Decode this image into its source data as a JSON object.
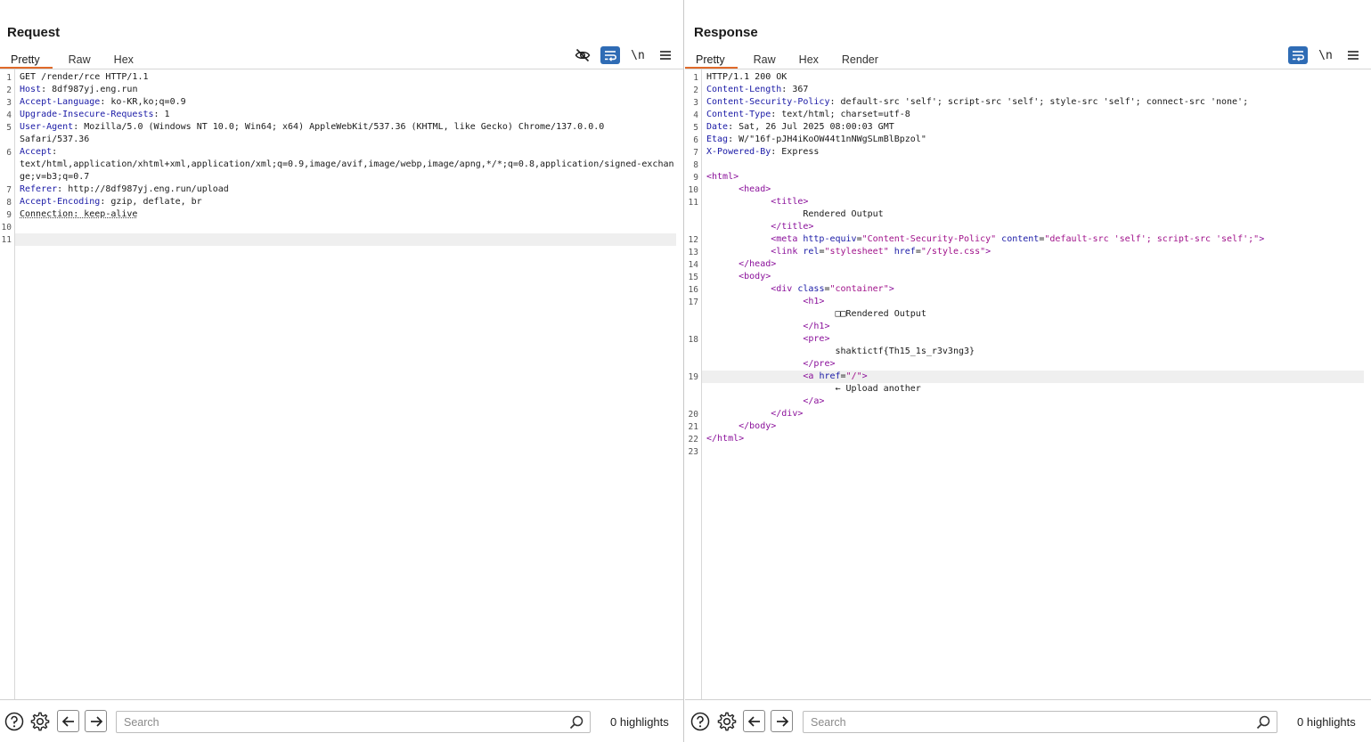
{
  "request": {
    "title": "Request",
    "tabs": [
      "Pretty",
      "Raw",
      "Hex"
    ],
    "active_tab": "Pretty",
    "newline_toggle": "\\n",
    "lines": [
      {
        "n": "1",
        "parts": [
          [
            "t",
            "GET /render/rce HTTP/1.1"
          ]
        ]
      },
      {
        "n": "2",
        "parts": [
          [
            "k",
            "Host"
          ],
          [
            "t",
            ": 8df987yj.eng.run"
          ]
        ]
      },
      {
        "n": "3",
        "parts": [
          [
            "k",
            "Accept-Language"
          ],
          [
            "t",
            ": ko-KR,ko;q=0.9"
          ]
        ]
      },
      {
        "n": "4",
        "parts": [
          [
            "k",
            "Upgrade-Insecure-Requests"
          ],
          [
            "t",
            ": 1"
          ]
        ]
      },
      {
        "n": "5",
        "parts": [
          [
            "k",
            "User-Agent"
          ],
          [
            "t",
            ": Mozilla/5.0 (Windows NT 10.0; Win64; x64) AppleWebKit/537.36 (KHTML, like Gecko) Chrome/137.0.0.0"
          ]
        ]
      },
      {
        "n": "",
        "parts": [
          [
            "t",
            "Safari/537.36"
          ]
        ]
      },
      {
        "n": "6",
        "parts": [
          [
            "k",
            "Accept"
          ],
          [
            "t",
            ":"
          ]
        ]
      },
      {
        "n": "",
        "parts": [
          [
            "t",
            "text/html,application/xhtml+xml,application/xml;q=0.9,image/avif,image/webp,image/apng,*/*;q=0.8,application/signed-exchan"
          ]
        ]
      },
      {
        "n": "",
        "parts": [
          [
            "t",
            "ge;v=b3;q=0.7"
          ]
        ]
      },
      {
        "n": "7",
        "parts": [
          [
            "k",
            "Referer"
          ],
          [
            "t",
            ": http://8df987yj.eng.run/upload"
          ]
        ]
      },
      {
        "n": "8",
        "parts": [
          [
            "k",
            "Accept-Encoding"
          ],
          [
            "t",
            ": gzip, deflate, br"
          ]
        ]
      },
      {
        "n": "9",
        "parts": [
          [
            "u",
            "Connection: keep-alive"
          ]
        ]
      },
      {
        "n": "10",
        "parts": []
      },
      {
        "n": "11",
        "parts": [],
        "hl": true
      }
    ],
    "search_placeholder": "Search",
    "highlights": "0 highlights"
  },
  "response": {
    "title": "Response",
    "tabs": [
      "Pretty",
      "Raw",
      "Hex",
      "Render"
    ],
    "active_tab": "Pretty",
    "newline_toggle": "\\n",
    "lines": [
      {
        "n": "1",
        "parts": [
          [
            "t",
            "HTTP/1.1 200 OK"
          ]
        ]
      },
      {
        "n": "2",
        "parts": [
          [
            "k",
            "Content-Length"
          ],
          [
            "t",
            ": 367"
          ]
        ]
      },
      {
        "n": "3",
        "parts": [
          [
            "k",
            "Content-Security-Policy"
          ],
          [
            "t",
            ": default-src 'self'; script-src 'self'; style-src 'self'; connect-src 'none';"
          ]
        ]
      },
      {
        "n": "4",
        "parts": [
          [
            "k",
            "Content-Type"
          ],
          [
            "t",
            ": text/html; charset=utf-8"
          ]
        ]
      },
      {
        "n": "5",
        "parts": [
          [
            "k",
            "Date"
          ],
          [
            "t",
            ": Sat, 26 Jul 2025 08:00:03 GMT"
          ]
        ]
      },
      {
        "n": "6",
        "parts": [
          [
            "k",
            "Etag"
          ],
          [
            "t",
            ": W/\"16f-pJH4iKoOW44t1nNWgSLmBlBpzol\""
          ]
        ]
      },
      {
        "n": "7",
        "parts": [
          [
            "k",
            "X-Powered-By"
          ],
          [
            "t",
            ": Express"
          ]
        ]
      },
      {
        "n": "8",
        "parts": []
      },
      {
        "n": "9",
        "parts": [
          [
            "g",
            "<html>"
          ]
        ]
      },
      {
        "n": "10",
        "parts": [
          [
            "t",
            "      "
          ],
          [
            "g",
            "<head>"
          ]
        ]
      },
      {
        "n": "11",
        "parts": [
          [
            "t",
            "            "
          ],
          [
            "g",
            "<title>"
          ]
        ]
      },
      {
        "n": "",
        "parts": [
          [
            "t",
            "                  Rendered Output"
          ]
        ]
      },
      {
        "n": "",
        "parts": [
          [
            "t",
            "            "
          ],
          [
            "g",
            "</title>"
          ]
        ]
      },
      {
        "n": "12",
        "parts": [
          [
            "t",
            "            "
          ],
          [
            "g",
            "<meta "
          ],
          [
            "a",
            "http-equiv"
          ],
          [
            "t",
            "="
          ],
          [
            "v",
            "\"Content-Security-Policy\""
          ],
          [
            "t",
            " "
          ],
          [
            "a",
            "content"
          ],
          [
            "t",
            "="
          ],
          [
            "v",
            "\"default-src 'self'; script-src 'self';\""
          ],
          [
            "g",
            ">"
          ]
        ]
      },
      {
        "n": "13",
        "parts": [
          [
            "t",
            "            "
          ],
          [
            "g",
            "<link "
          ],
          [
            "a",
            "rel"
          ],
          [
            "t",
            "="
          ],
          [
            "v",
            "\"stylesheet\""
          ],
          [
            "t",
            " "
          ],
          [
            "a",
            "href"
          ],
          [
            "t",
            "="
          ],
          [
            "v",
            "\"/style.css\""
          ],
          [
            "g",
            ">"
          ]
        ]
      },
      {
        "n": "14",
        "parts": [
          [
            "t",
            "      "
          ],
          [
            "g",
            "</head>"
          ]
        ]
      },
      {
        "n": "15",
        "parts": [
          [
            "t",
            "      "
          ],
          [
            "g",
            "<body>"
          ]
        ]
      },
      {
        "n": "16",
        "parts": [
          [
            "t",
            "            "
          ],
          [
            "g",
            "<div "
          ],
          [
            "a",
            "class"
          ],
          [
            "t",
            "="
          ],
          [
            "v",
            "\"container\""
          ],
          [
            "g",
            ">"
          ]
        ]
      },
      {
        "n": "17",
        "parts": [
          [
            "t",
            "                  "
          ],
          [
            "g",
            "<h1>"
          ]
        ]
      },
      {
        "n": "",
        "parts": [
          [
            "t",
            "                        □□Rendered Output"
          ]
        ]
      },
      {
        "n": "",
        "parts": [
          [
            "t",
            "                  "
          ],
          [
            "g",
            "</h1>"
          ]
        ]
      },
      {
        "n": "18",
        "parts": [
          [
            "t",
            "                  "
          ],
          [
            "g",
            "<pre>"
          ]
        ]
      },
      {
        "n": "",
        "parts": [
          [
            "t",
            "                        shaktictf{Th15_1s_r3v3ng3}"
          ]
        ]
      },
      {
        "n": "",
        "parts": [
          [
            "t",
            "                  "
          ],
          [
            "g",
            "</pre>"
          ]
        ]
      },
      {
        "n": "19",
        "parts": [
          [
            "t",
            "                  "
          ],
          [
            "g",
            "<a "
          ],
          [
            "a",
            "href"
          ],
          [
            "t",
            "="
          ],
          [
            "v",
            "\"/\""
          ],
          [
            "g",
            ">"
          ]
        ],
        "hl": true
      },
      {
        "n": "",
        "parts": [
          [
            "t",
            "                        ← Upload another"
          ]
        ]
      },
      {
        "n": "",
        "parts": [
          [
            "t",
            "                  "
          ],
          [
            "g",
            "</a>"
          ]
        ]
      },
      {
        "n": "20",
        "parts": [
          [
            "t",
            "            "
          ],
          [
            "g",
            "</div>"
          ]
        ]
      },
      {
        "n": "21",
        "parts": [
          [
            "t",
            "      "
          ],
          [
            "g",
            "</body>"
          ]
        ]
      },
      {
        "n": "22",
        "parts": [
          [
            "g",
            "</html>"
          ]
        ]
      },
      {
        "n": "23",
        "parts": []
      }
    ],
    "search_placeholder": "Search",
    "highlights": "0 highlights"
  },
  "icons": {
    "hide": "eye-slash-icon",
    "wrap": "word-wrap-icon",
    "menu": "hamburger-menu-icon",
    "help": "help-icon",
    "settings": "gear-icon",
    "back": "arrow-left-icon",
    "forward": "arrow-right-icon",
    "search": "magnifier-icon"
  },
  "colors": {
    "accent": "#e06a2b",
    "active_blue": "#2f6cb5",
    "header_key": "#1a1aa6",
    "tag": "#8a0f9a",
    "attr_value": "#a0118a"
  }
}
